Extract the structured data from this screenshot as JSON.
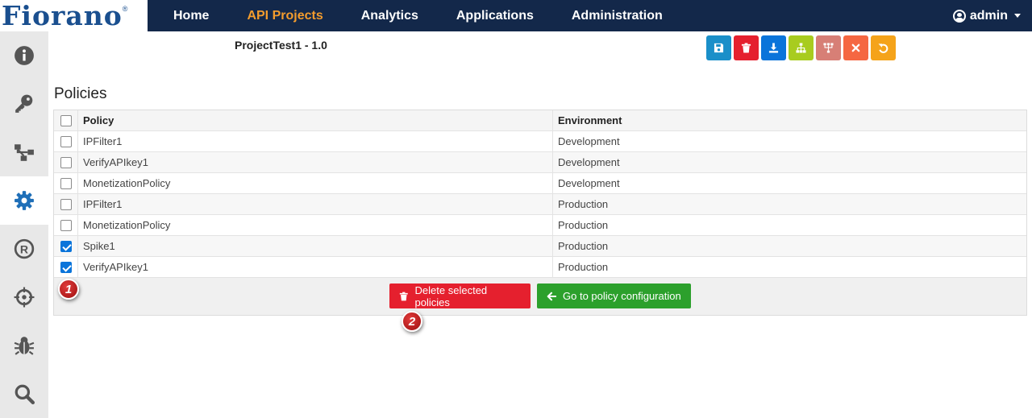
{
  "brand": {
    "logo_text": "Fiorano",
    "logo_mark": "®"
  },
  "nav": {
    "items": [
      {
        "label": "Home",
        "active": false
      },
      {
        "label": "API Projects",
        "active": true
      },
      {
        "label": "Analytics",
        "active": false
      },
      {
        "label": "Applications",
        "active": false
      },
      {
        "label": "Administration",
        "active": false
      }
    ],
    "user": "admin"
  },
  "sidebar": {
    "items": [
      {
        "icon": "info-icon",
        "active": false
      },
      {
        "icon": "key-icon",
        "active": false
      },
      {
        "icon": "flow-icon",
        "active": false
      },
      {
        "icon": "gear-icon",
        "active": true
      },
      {
        "icon": "registered-icon",
        "active": false
      },
      {
        "icon": "crosshair-icon",
        "active": false
      },
      {
        "icon": "bug-icon",
        "active": false
      },
      {
        "icon": "search-icon",
        "active": false
      }
    ]
  },
  "project": {
    "title": "ProjectTest1 - 1.0"
  },
  "toolbar": {
    "buttons": [
      {
        "icon": "save-icon",
        "color": "#1a8fc9"
      },
      {
        "icon": "trash-icon",
        "color": "#e5202e"
      },
      {
        "icon": "download-icon",
        "color": "#0a74da"
      },
      {
        "icon": "sitemap-icon",
        "color": "#a8cc1f"
      },
      {
        "icon": "hierarchy-icon",
        "color": "#d77f76"
      },
      {
        "icon": "close-icon",
        "color": "#f56742"
      },
      {
        "icon": "undo-icon",
        "color": "#f5a31a"
      }
    ]
  },
  "policies": {
    "title": "Policies",
    "columns": [
      "Policy",
      "Environment"
    ],
    "rows": [
      {
        "policy": "IPFilter1",
        "environment": "Development",
        "checked": false
      },
      {
        "policy": "VerifyAPIkey1",
        "environment": "Development",
        "checked": false
      },
      {
        "policy": "MonetizationPolicy",
        "environment": "Development",
        "checked": false
      },
      {
        "policy": "IPFilter1",
        "environment": "Production",
        "checked": false
      },
      {
        "policy": "MonetizationPolicy",
        "environment": "Production",
        "checked": false
      },
      {
        "policy": "Spike1",
        "environment": "Production",
        "checked": true
      },
      {
        "policy": "VerifyAPIkey1",
        "environment": "Production",
        "checked": true
      }
    ],
    "delete_label": "Delete selected policies",
    "goto_label": "Go to policy configuration"
  },
  "annotations": {
    "badge1": "1",
    "badge2": "2"
  }
}
